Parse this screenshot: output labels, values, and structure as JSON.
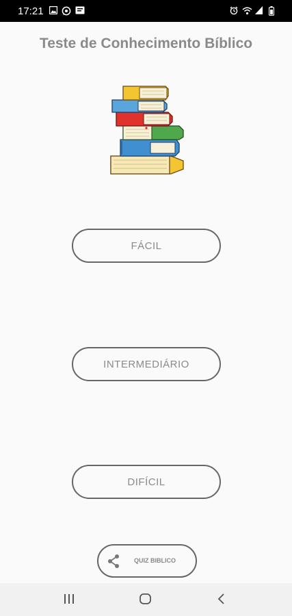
{
  "status_bar": {
    "time": "17:21",
    "left_icons": [
      "image-icon",
      "whatsapp-icon",
      "notification-icon"
    ],
    "right_icons": [
      "alarm-icon",
      "wifi-icon",
      "signal-icon",
      "battery-icon"
    ]
  },
  "app": {
    "title": "Teste de Conhecimento Bíblico",
    "illustration": "book-stack-icon"
  },
  "levels": [
    {
      "label": "FÁCIL"
    },
    {
      "label": "INTERMEDIÁRIO"
    },
    {
      "label": "DIFÍCIL"
    }
  ],
  "share": {
    "label": "QUIZ BIBLICO",
    "icon": "share-icon"
  },
  "nav_bar": {
    "buttons": [
      "recents-icon",
      "home-icon",
      "back-icon"
    ]
  },
  "colors": {
    "status_bar_bg": "#000000",
    "background": "#fafafa",
    "text_gray": "#8a8a8a",
    "button_border": "#666666",
    "nav_bar_bg": "#f1f1f1"
  }
}
